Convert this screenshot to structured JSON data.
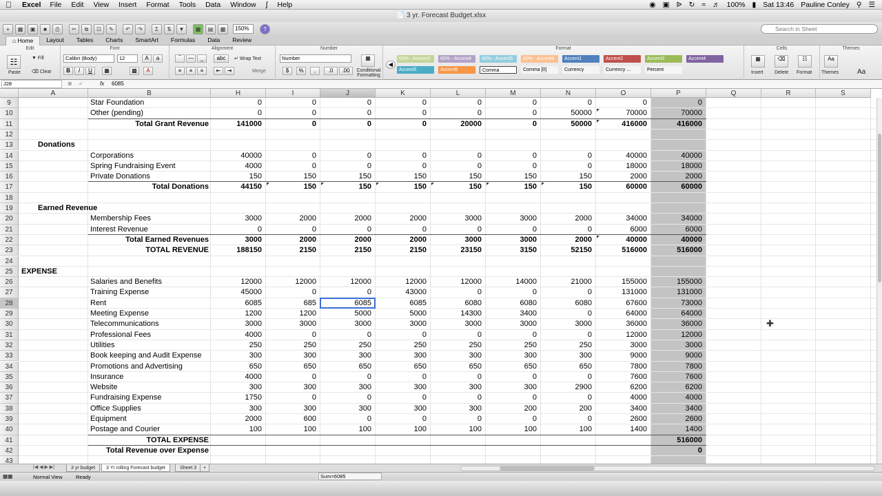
{
  "menubar": {
    "app": "Excel",
    "items": [
      "File",
      "Edit",
      "View",
      "Insert",
      "Format",
      "Tools",
      "Data",
      "Window",
      "Help"
    ],
    "battery": "100%",
    "clock": "Sat 13:46",
    "user": "Pauline Conley"
  },
  "window": {
    "title": "3 yr. Forecast Budget.xlsx"
  },
  "toolbar": {
    "zoom": "150%",
    "search_placeholder": "Search in Sheet"
  },
  "ribbon": {
    "tabs": [
      "Home",
      "Layout",
      "Tables",
      "Charts",
      "SmartArt",
      "Formulas",
      "Data",
      "Review"
    ],
    "active_tab": "Home",
    "groups": {
      "edit": "Edit",
      "font": "Font",
      "alignment": "Alignment",
      "number": "Number",
      "format": "Format",
      "cells": "Cells",
      "themes": "Themes"
    },
    "paste": "Paste",
    "fill": "Fill",
    "clear": "Clear",
    "font_name": "Calibri (Body)",
    "font_size": "12",
    "wrap_text": "Wrap Text",
    "merge": "Merge",
    "number_format": "Number",
    "conditional_formatting": "Conditional Formatting",
    "styles": [
      {
        "label": "60% - Accent3",
        "bg": "#c2d69a",
        "fg": "#ffffff"
      },
      {
        "label": "60% - Accent4",
        "bg": "#b3a2c7",
        "fg": "#ffffff"
      },
      {
        "label": "60% - Accent5",
        "bg": "#93cddd",
        "fg": "#ffffff"
      },
      {
        "label": "60% - Accent6",
        "bg": "#fac090",
        "fg": "#ffffff"
      },
      {
        "label": "Accent1",
        "bg": "#4f81bd",
        "fg": "#ffffff"
      },
      {
        "label": "Accent2",
        "bg": "#c0504d",
        "fg": "#ffffff"
      },
      {
        "label": "Accent3",
        "bg": "#9bbb59",
        "fg": "#ffffff"
      },
      {
        "label": "Accent4",
        "bg": "#8064a2",
        "fg": "#ffffff"
      },
      {
        "label": "Accent5",
        "bg": "#4bacc6",
        "fg": "#ffffff"
      },
      {
        "label": "Accent6",
        "bg": "#f79646",
        "fg": "#ffffff"
      },
      {
        "label": "Comma",
        "bg": "#ffffff",
        "fg": "#000000"
      },
      {
        "label": "Comma [0]",
        "bg": "#f5f5f5",
        "fg": "#000000"
      },
      {
        "label": "Currency",
        "bg": "#f5f5f5",
        "fg": "#000000"
      },
      {
        "label": "Currency ...",
        "bg": "#f5f5f5",
        "fg": "#000000"
      },
      {
        "label": "Percent",
        "bg": "#f5f5f5",
        "fg": "#000000"
      }
    ],
    "insert": "Insert",
    "delete": "Delete",
    "format_btn": "Format",
    "themes_btn": "Themes",
    "font_style_btn": "Aa"
  },
  "formula_bar": {
    "cell_ref": "J28",
    "fx": "fx",
    "value": "6085"
  },
  "sheet": {
    "columns": [
      "A",
      "B",
      "H",
      "I",
      "J",
      "K",
      "L",
      "M",
      "N",
      "O",
      "P",
      "Q",
      "R",
      "S"
    ],
    "selected_column": "J",
    "selected_row": "28",
    "row_numbers": [
      "9",
      "10",
      "11",
      "12",
      "13",
      "14",
      "15",
      "16",
      "17",
      "18",
      "19",
      "20",
      "21",
      "22",
      "23",
      "24",
      "25",
      "26",
      "27",
      "28",
      "29",
      "30",
      "31",
      "32",
      "33",
      "34",
      "35",
      "36",
      "37",
      "38",
      "39",
      "40",
      "41",
      "42",
      "43"
    ],
    "rows": [
      {
        "a": "",
        "b": "Star Foundation",
        "v": [
          "0",
          "0",
          "0",
          "0",
          "0",
          "0",
          "0",
          "0",
          "0"
        ]
      },
      {
        "a": "",
        "b": "Other (pending)",
        "v": [
          "0",
          "0",
          "0",
          "0",
          "0",
          "0",
          "50000",
          "70000",
          "70000"
        ]
      },
      {
        "a": "",
        "b": "Total Grant Revenue",
        "bold": true,
        "right": true,
        "total": true,
        "v": [
          "141000",
          "0",
          "0",
          "0",
          "20000",
          "0",
          "50000",
          "416000",
          "416000"
        ]
      },
      {
        "a": "",
        "b": "",
        "v": []
      },
      {
        "a": "Donations",
        "b": "",
        "section": true,
        "v": []
      },
      {
        "a": "",
        "b": "Corporations",
        "v": [
          "40000",
          "0",
          "0",
          "0",
          "0",
          "0",
          "0",
          "40000",
          "40000"
        ]
      },
      {
        "a": "",
        "b": "Spring Fundraising Event",
        "v": [
          "4000",
          "0",
          "0",
          "0",
          "0",
          "0",
          "0",
          "18000",
          "18000"
        ]
      },
      {
        "a": "",
        "b": "Private Donations",
        "v": [
          "150",
          "150",
          "150",
          "150",
          "150",
          "150",
          "150",
          "2000",
          "2000"
        ]
      },
      {
        "a": "",
        "b": "Total Donations",
        "bold": true,
        "right": true,
        "total": true,
        "v": [
          "44150",
          "150",
          "150",
          "150",
          "150",
          "150",
          "150",
          "60000",
          "60000"
        ]
      },
      {
        "a": "",
        "b": "",
        "v": []
      },
      {
        "a": "Earned Revenue",
        "b": "",
        "section": true,
        "v": []
      },
      {
        "a": "",
        "b": "Membership Fees",
        "v": [
          "3000",
          "2000",
          "2000",
          "2000",
          "3000",
          "3000",
          "2000",
          "34000",
          "34000"
        ]
      },
      {
        "a": "",
        "b": "Interest Revenue",
        "v": [
          "0",
          "0",
          "0",
          "0",
          "0",
          "0",
          "0",
          "6000",
          "6000"
        ]
      },
      {
        "a": "",
        "b": "Total Earned Revenues",
        "bold": true,
        "right": true,
        "total": true,
        "v": [
          "3000",
          "2000",
          "2000",
          "2000",
          "3000",
          "3000",
          "2000",
          "40000",
          "40000"
        ]
      },
      {
        "a": "",
        "b": "TOTAL REVENUE",
        "bold": true,
        "right": true,
        "v": [
          "188150",
          "2150",
          "2150",
          "2150",
          "23150",
          "3150",
          "52150",
          "516000",
          "516000"
        ]
      },
      {
        "a": "",
        "b": "",
        "v": []
      },
      {
        "a": "EXPENSE",
        "b": "",
        "section": true,
        "left": true,
        "v": []
      },
      {
        "a": "",
        "b": "Salaries and Benefits",
        "v": [
          "12000",
          "12000",
          "12000",
          "12000",
          "12000",
          "14000",
          "21000",
          "155000",
          "155000"
        ]
      },
      {
        "a": "",
        "b": "Training Expense",
        "v": [
          "45000",
          "0",
          "0",
          "43000",
          "0",
          "0",
          "0",
          "131000",
          "131000"
        ]
      },
      {
        "a": "",
        "b": "Rent",
        "v": [
          "6085",
          "685",
          "6085",
          "6085",
          "6080",
          "6080",
          "6080",
          "67600",
          "73000"
        ]
      },
      {
        "a": "",
        "b": "Meeting Expense",
        "v": [
          "1200",
          "1200",
          "5000",
          "5000",
          "14300",
          "3400",
          "0",
          "64000",
          "64000"
        ]
      },
      {
        "a": "",
        "b": "Telecommunications",
        "v": [
          "3000",
          "3000",
          "3000",
          "3000",
          "3000",
          "3000",
          "3000",
          "36000",
          "36000"
        ]
      },
      {
        "a": "",
        "b": "Professional Fees",
        "v": [
          "4000",
          "0",
          "0",
          "0",
          "0",
          "0",
          "0",
          "12000",
          "12000"
        ]
      },
      {
        "a": "",
        "b": "Utilities",
        "v": [
          "250",
          "250",
          "250",
          "250",
          "250",
          "250",
          "250",
          "3000",
          "3000"
        ]
      },
      {
        "a": "",
        "b": "Book keeping and Audit Expense",
        "v": [
          "300",
          "300",
          "300",
          "300",
          "300",
          "300",
          "300",
          "9000",
          "9000"
        ]
      },
      {
        "a": "",
        "b": "Promotions and Advertising",
        "v": [
          "650",
          "650",
          "650",
          "650",
          "650",
          "650",
          "650",
          "7800",
          "7800"
        ]
      },
      {
        "a": "",
        "b": "Insurance",
        "v": [
          "4000",
          "0",
          "0",
          "0",
          "0",
          "0",
          "0",
          "7600",
          "7600"
        ]
      },
      {
        "a": "",
        "b": "Website",
        "v": [
          "300",
          "300",
          "300",
          "300",
          "300",
          "300",
          "2900",
          "6200",
          "6200"
        ]
      },
      {
        "a": "",
        "b": "Fundraising Expense",
        "v": [
          "1750",
          "0",
          "0",
          "0",
          "0",
          "0",
          "0",
          "4000",
          "4000"
        ]
      },
      {
        "a": "",
        "b": "Office Supplies",
        "v": [
          "300",
          "300",
          "300",
          "300",
          "300",
          "200",
          "200",
          "3400",
          "3400"
        ]
      },
      {
        "a": "",
        "b": "Equipment",
        "v": [
          "2000",
          "600",
          "0",
          "0",
          "0",
          "0",
          "0",
          "2600",
          "2600"
        ]
      },
      {
        "a": "",
        "b": "Postage and Courier",
        "v": [
          "100",
          "100",
          "100",
          "100",
          "100",
          "100",
          "100",
          "1400",
          "1400"
        ]
      },
      {
        "a": "",
        "b": "TOTAL EXPENSE",
        "bold": true,
        "right": true,
        "total": true,
        "v": [
          "",
          "",
          "",
          "",
          "",
          "",
          "",
          "",
          "516000"
        ]
      },
      {
        "a": "",
        "b": "Total Revenue over Expense",
        "bold": true,
        "right": true,
        "total": true,
        "v": [
          "",
          "",
          "",
          "",
          "",
          "",
          "",
          "",
          "0"
        ]
      },
      {
        "a": "",
        "b": "",
        "v": []
      }
    ]
  },
  "sheet_tabs": [
    "3 yr budget",
    "3 Yr rolling Forecast budget",
    "Sheet 3"
  ],
  "active_sheet": "3 Yr rolling Forecast budget",
  "status": {
    "view": "Normal View",
    "state": "Ready",
    "sum": "Sum=6085"
  }
}
